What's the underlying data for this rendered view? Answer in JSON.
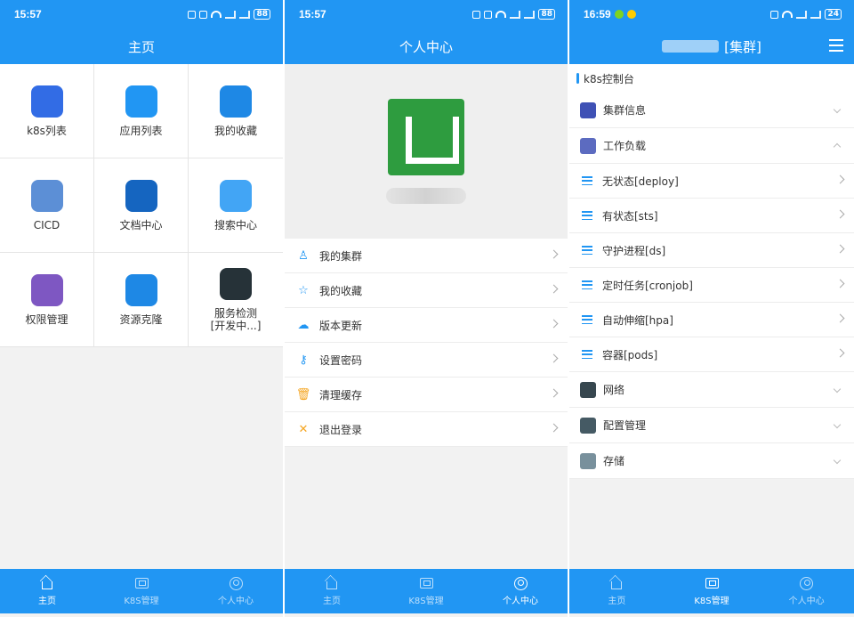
{
  "panel1": {
    "status": {
      "time": "15:57",
      "battery": "88"
    },
    "title": "主页",
    "grid": [
      {
        "label": "k8s列表",
        "icon": "kubernetes-icon",
        "color": "#326ce5"
      },
      {
        "label": "应用列表",
        "icon": "app-store-icon",
        "color": "#2196f3"
      },
      {
        "label": "我的收藏",
        "icon": "star-icon",
        "color": "#1e88e5"
      },
      {
        "label": "CICD",
        "icon": "cicd-icon",
        "color": "#5c8fd6"
      },
      {
        "label": "文档中心",
        "icon": "document-wave-icon",
        "color": "#1565c0"
      },
      {
        "label": "搜索中心",
        "icon": "search-icon",
        "color": "#42a5f5"
      },
      {
        "label": "权限管理",
        "icon": "shield-icon",
        "color": "#7e57c2"
      },
      {
        "label": "资源克隆",
        "icon": "clone-icon",
        "color": "#1e88e5"
      },
      {
        "label": "服务检测\n[开发中...]",
        "icon": "speedometer-icon",
        "color": "#263238"
      }
    ],
    "tabs": [
      {
        "label": "主页",
        "icon": "home-icon",
        "active": true
      },
      {
        "label": "K8S管理",
        "icon": "k8s-box-icon",
        "active": false
      },
      {
        "label": "个人中心",
        "icon": "user-icon",
        "active": false
      }
    ]
  },
  "panel2": {
    "status": {
      "time": "15:57",
      "battery": "88"
    },
    "title": "个人中心",
    "menu": [
      {
        "label": "我的集群",
        "icon": "person-icon",
        "glyph": "♙"
      },
      {
        "label": "我的收藏",
        "icon": "star-outline-icon",
        "glyph": "☆"
      },
      {
        "label": "版本更新",
        "icon": "cloud-icon",
        "glyph": "☁"
      },
      {
        "label": "设置密码",
        "icon": "user-key-icon",
        "glyph": "⚷"
      },
      {
        "label": "清理缓存",
        "icon": "trash-icon",
        "glyph": "🗑"
      },
      {
        "label": "退出登录",
        "icon": "close-icon",
        "glyph": "✕"
      }
    ],
    "tabs": [
      {
        "label": "主页",
        "icon": "home-icon",
        "active": false
      },
      {
        "label": "K8S管理",
        "icon": "k8s-box-icon",
        "active": false
      },
      {
        "label": "个人中心",
        "icon": "user-icon",
        "active": true
      }
    ]
  },
  "panel3": {
    "status": {
      "time": "16:59",
      "battery": "24"
    },
    "title": "[集群]",
    "section": "k8s控制台",
    "groups_top": [
      {
        "label": "集群信息",
        "icon": "cluster-info-icon",
        "color": "#3f51b5",
        "open": false
      },
      {
        "label": "工作负载",
        "icon": "workload-icon",
        "color": "#5c6bc0",
        "open": true
      }
    ],
    "workloads": [
      {
        "label": "无状态[deploy]"
      },
      {
        "label": "有状态[sts]"
      },
      {
        "label": "守护进程[ds]"
      },
      {
        "label": "定时任务[cronjob]"
      },
      {
        "label": "自动伸缩[hpa]"
      },
      {
        "label": "容器[pods]"
      }
    ],
    "groups_bottom": [
      {
        "label": "网络",
        "icon": "network-icon",
        "color": "#37474f"
      },
      {
        "label": "配置管理",
        "icon": "config-icon",
        "color": "#455a64"
      },
      {
        "label": "存储",
        "icon": "storage-icon",
        "color": "#78909c"
      }
    ],
    "tabs": [
      {
        "label": "主页",
        "icon": "home-icon",
        "active": false
      },
      {
        "label": "K8S管理",
        "icon": "k8s-box-icon",
        "active": true
      },
      {
        "label": "个人中心",
        "icon": "user-icon",
        "active": false
      }
    ]
  }
}
